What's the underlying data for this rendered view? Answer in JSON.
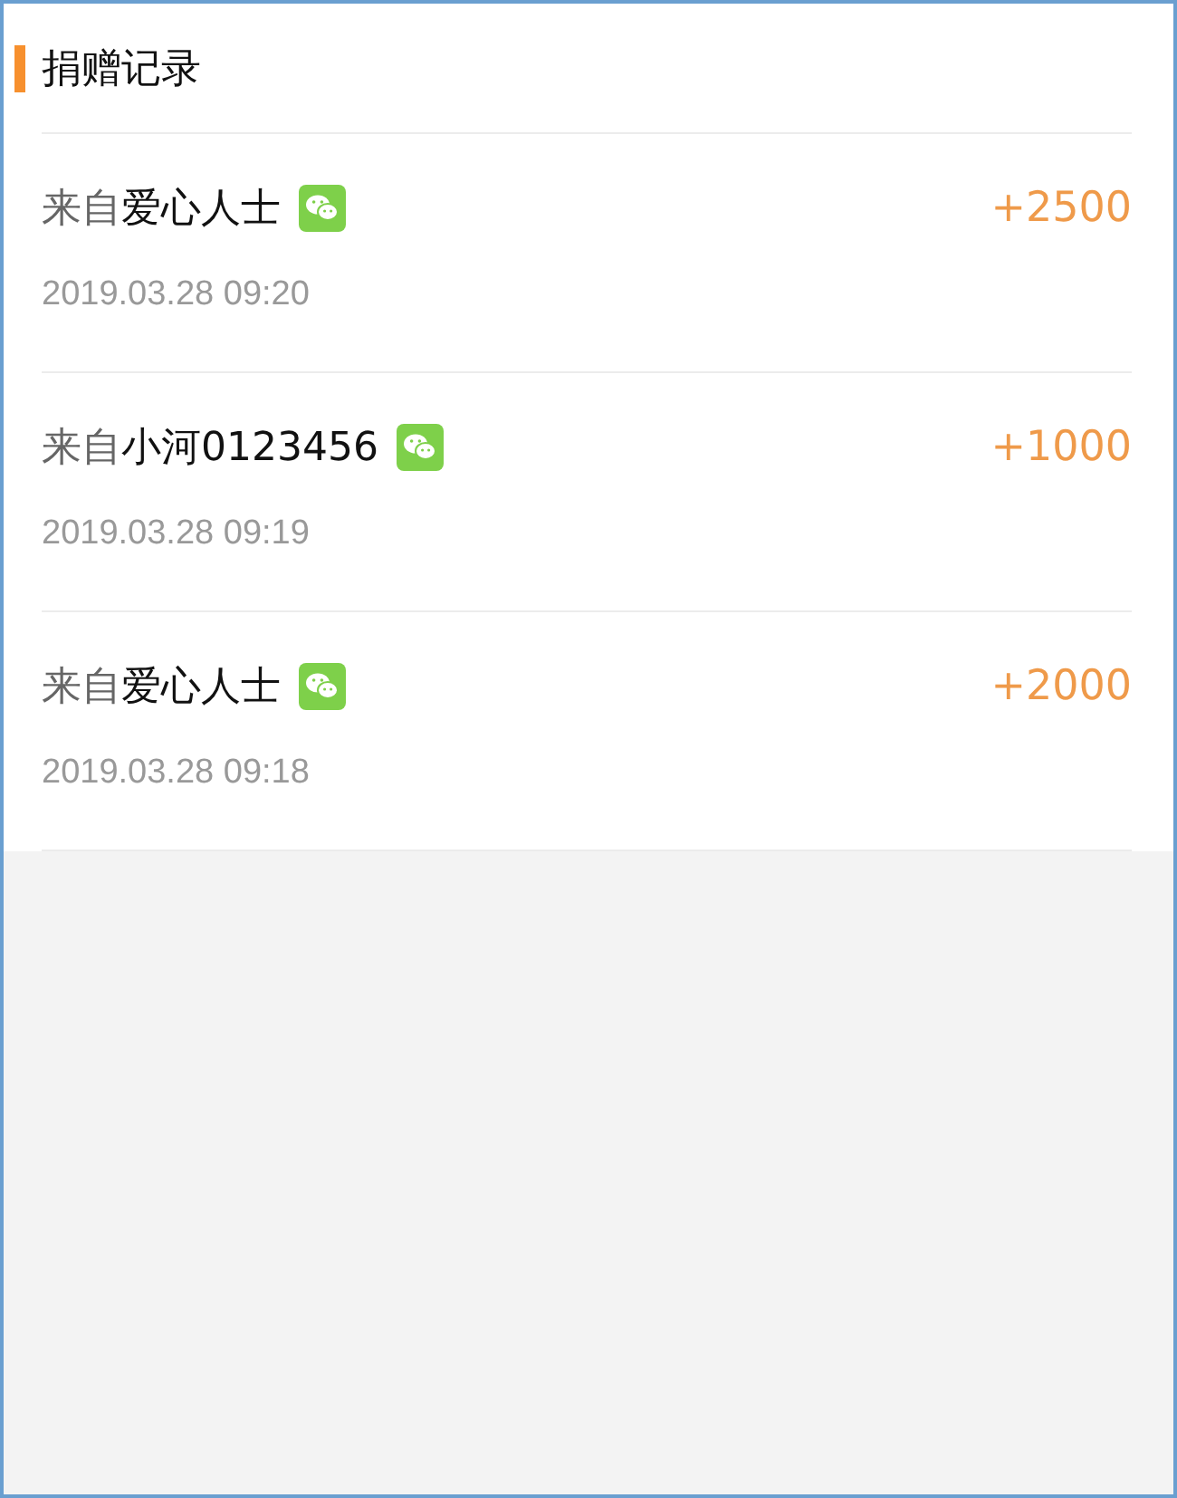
{
  "section": {
    "title": "捐赠记录"
  },
  "records": [
    {
      "from_label": "来自",
      "donor": "爱心人士",
      "amount": "+2500",
      "time": "2019.03.28 09:20"
    },
    {
      "from_label": "来自",
      "donor": "小河0123456",
      "amount": "+1000",
      "time": "2019.03.28 09:19"
    },
    {
      "from_label": "来自",
      "donor": "爱心人士",
      "amount": "+2000",
      "time": "2019.03.28 09:18"
    }
  ]
}
